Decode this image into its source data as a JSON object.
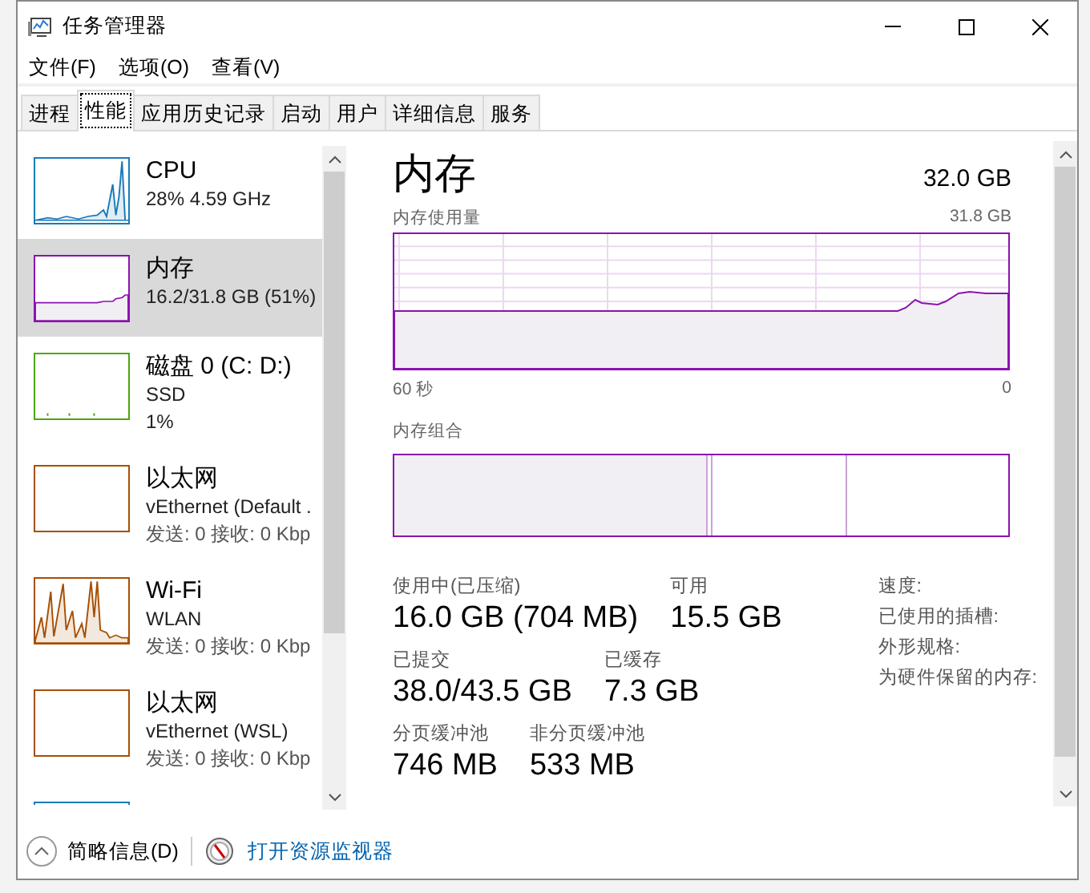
{
  "window": {
    "title": "任务管理器"
  },
  "menu": [
    "文件(F)",
    "选项(O)",
    "查看(V)"
  ],
  "tabs": [
    {
      "label": "进程",
      "selected": false
    },
    {
      "label": "性能",
      "selected": true
    },
    {
      "label": "应用历史记录",
      "selected": false
    },
    {
      "label": "启动",
      "selected": false
    },
    {
      "label": "用户",
      "selected": false
    },
    {
      "label": "详细信息",
      "selected": false
    },
    {
      "label": "服务",
      "selected": false
    }
  ],
  "devices": [
    {
      "kind": "cpu",
      "name": "CPU",
      "lines": [
        "28% 4.59 GHz"
      ],
      "selected": false,
      "color": "#1a7ab8"
    },
    {
      "kind": "memory",
      "name": "内存",
      "lines": [
        "16.2/31.8 GB (51%)"
      ],
      "selected": true,
      "color": "#8b12ae"
    },
    {
      "kind": "disk",
      "name": "磁盘 0 (C: D:)",
      "lines": [
        "SSD",
        "1%"
      ],
      "selected": false,
      "color": "#4da60c"
    },
    {
      "kind": "ethernet",
      "name": "以太网",
      "lines": [
        "vEthernet (Default .",
        "发送: 0 接收: 0 Kbp"
      ],
      "selected": false,
      "color": "#a74f01"
    },
    {
      "kind": "wifi",
      "name": "Wi-Fi",
      "lines": [
        "WLAN",
        "发送: 0 接收: 0 Kbp"
      ],
      "selected": false,
      "color": "#a74f01"
    },
    {
      "kind": "ethernet",
      "name": "以太网",
      "lines": [
        "vEthernet (WSL)",
        "发送: 0 接收: 0 Kbp"
      ],
      "selected": false,
      "color": "#a74f01"
    },
    {
      "kind": "gpu",
      "selected": false,
      "color": "#1a7ab8"
    }
  ],
  "detail": {
    "title": "内存",
    "total": "32.0 GB",
    "usage_label": "内存使用量",
    "usage_max": "31.8 GB",
    "time_start": "60 秒",
    "time_end": "0",
    "composition_label": "内存组合",
    "stat_rows": [
      [
        {
          "label": "使用中(已压缩)",
          "value": "16.0 GB (704 MB)"
        },
        {
          "label": "可用",
          "value": "15.5 GB"
        }
      ],
      [
        {
          "label": "已提交",
          "value": "38.0/43.5 GB"
        },
        {
          "label": "已缓存",
          "value": "7.3 GB"
        }
      ],
      [
        {
          "label": "分页缓冲池",
          "value": "746 MB"
        },
        {
          "label": "非分页缓冲池",
          "value": "533 MB"
        }
      ]
    ],
    "specs": [
      "速度:",
      "已使用的插槽:",
      "外形规格:",
      "为硬件保留的内存:"
    ]
  },
  "footer": {
    "summary": "简略信息(D)",
    "link": "打开资源监视器"
  }
}
